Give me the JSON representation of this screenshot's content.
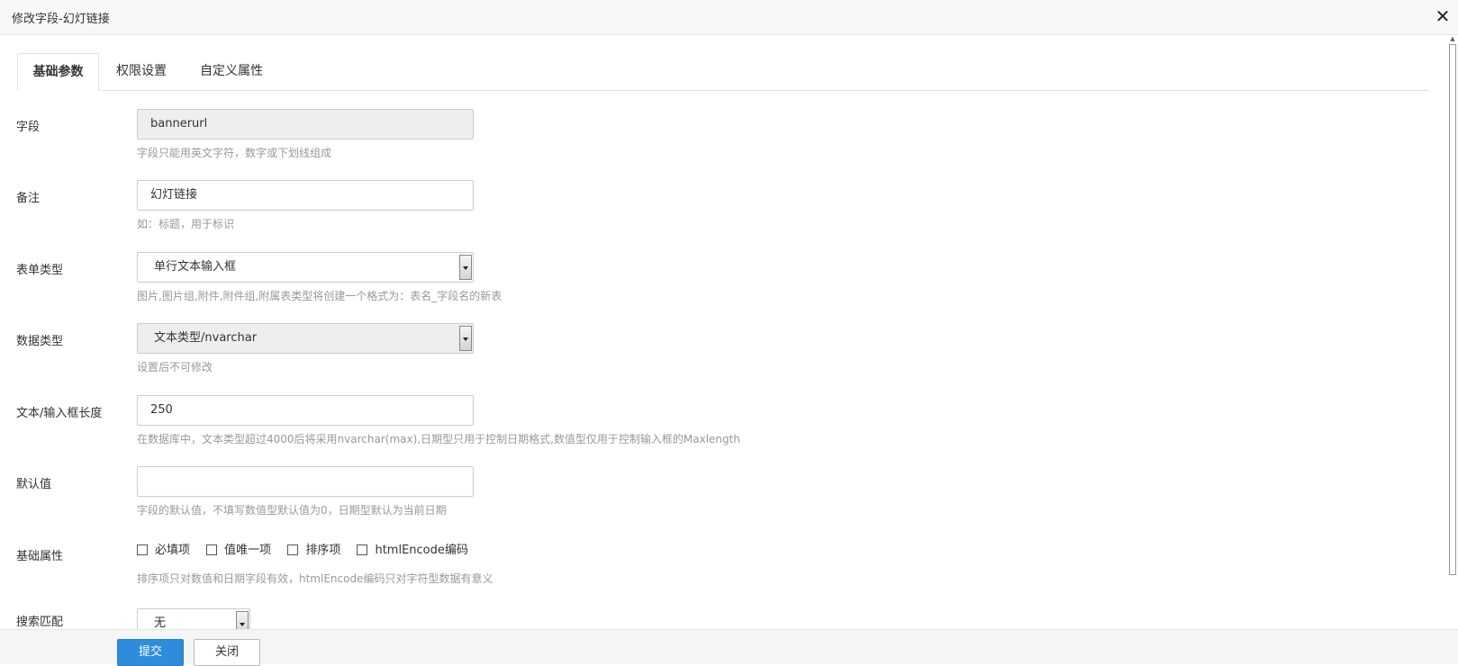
{
  "dialog": {
    "title": "修改字段-幻灯链接",
    "close_glyph": "✕"
  },
  "tabs": [
    {
      "label": "基础参数",
      "active": true
    },
    {
      "label": "权限设置",
      "active": false
    },
    {
      "label": "自定义属性",
      "active": false
    }
  ],
  "form": {
    "field": {
      "label": "字段",
      "value": "bannerurl",
      "hint": "字段只能用英文字符，数字或下划线组成"
    },
    "remark": {
      "label": "备注",
      "value": "幻灯链接",
      "hint": "如：标题，用于标识"
    },
    "form_type": {
      "label": "表单类型",
      "selected": "单行文本输入框",
      "hint": "图片,图片组,附件,附件组,附属表类型将创建一个格式为：表名_字段名的新表"
    },
    "data_type": {
      "label": "数据类型",
      "selected": "文本类型/nvarchar",
      "hint": "设置后不可修改"
    },
    "length": {
      "label": "文本/输入框长度",
      "value": "250",
      "hint": "在数据库中，文本类型超过4000后将采用nvarchar(max),日期型只用于控制日期格式,数值型仅用于控制输入框的Maxlength"
    },
    "default_value": {
      "label": "默认值",
      "value": "",
      "hint": "字段的默认值，不填写数值型默认值为0，日期型默认为当前日期"
    },
    "base_attrs": {
      "label": "基础属性",
      "options": [
        {
          "label": "必填项",
          "checked": false
        },
        {
          "label": "值唯一项",
          "checked": false
        },
        {
          "label": "排序项",
          "checked": false
        },
        {
          "label": "htmlEncode编码",
          "checked": false
        }
      ],
      "hint": "排序项只对数值和日期字段有效，htmlEncode编码只对字符型数据有意义"
    },
    "search_match": {
      "label": "搜索匹配",
      "selected": "无"
    }
  },
  "footer": {
    "submit_label": "提交",
    "close_label": "关闭"
  },
  "colors": {
    "primary": "#2d8cdc",
    "hint": "#999999"
  }
}
